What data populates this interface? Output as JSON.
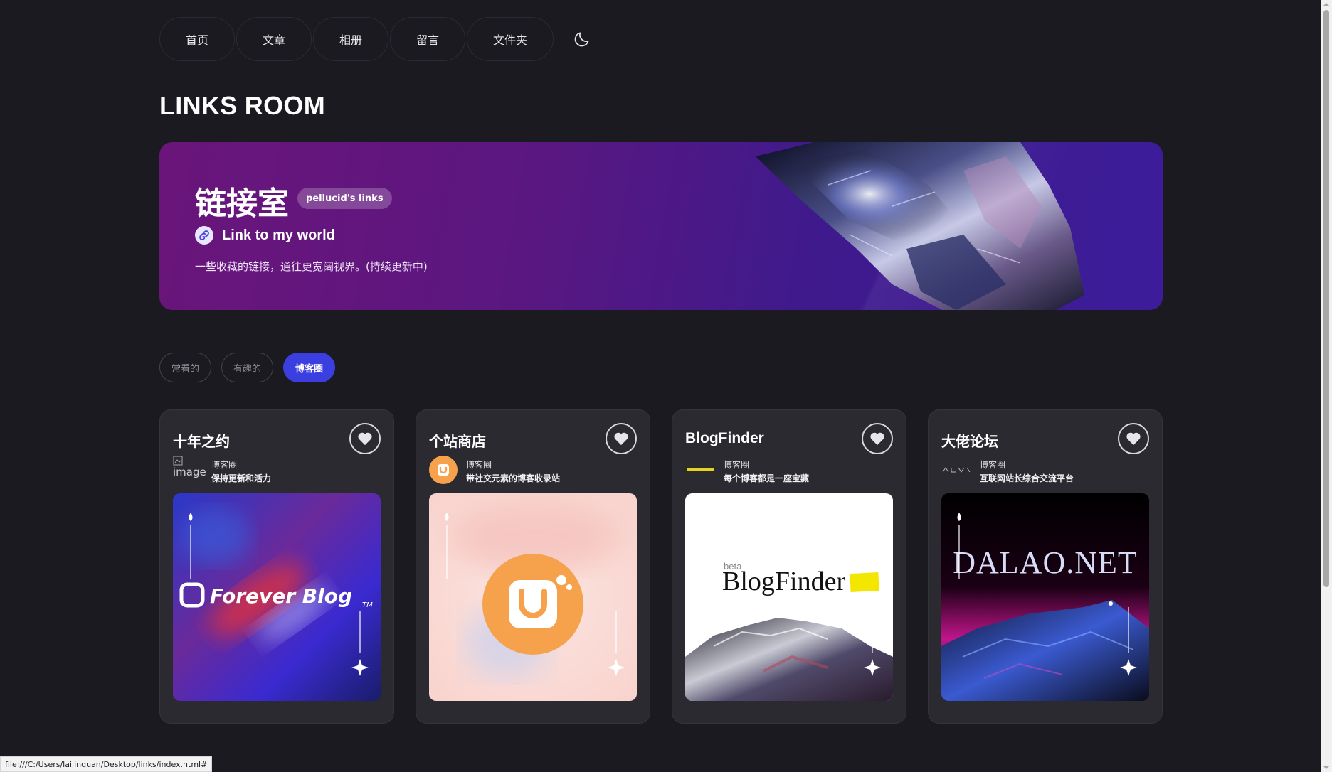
{
  "nav": {
    "items": [
      {
        "label": "首页"
      },
      {
        "label": "文章"
      },
      {
        "label": "相册"
      },
      {
        "label": "留言"
      },
      {
        "label": "文件夹"
      }
    ],
    "theme_icon": "moon-icon"
  },
  "page_title": "LINKS ROOM",
  "banner": {
    "title": "链接室",
    "badge": "pellucid's links",
    "subtitle": "Link to my world",
    "description": "一些收藏的链接，通往更宽阔视界。(持续更新中)"
  },
  "filters": [
    {
      "label": "常看的",
      "active": false
    },
    {
      "label": "有趣的",
      "active": false
    },
    {
      "label": "博客圈",
      "active": true
    }
  ],
  "cards": [
    {
      "name": "十年之约",
      "category": "博客圈",
      "description": "保持更新和活力",
      "avatar_alt": "image",
      "thumb_text": "Forever Blog",
      "thumb_tm": "TM"
    },
    {
      "name": "个站商店",
      "category": "博客圈",
      "description": "带社交元素的博客收录站"
    },
    {
      "name": "BlogFinder",
      "category": "博客圈",
      "description": "每个博客都是一座宝藏",
      "thumb_beta": "beta",
      "thumb_text": "BlogFinder"
    },
    {
      "name": "大佬论坛",
      "category": "博客圈",
      "description": "互联网站长综合交流平台",
      "thumb_text": "DALAO.NET"
    }
  ],
  "status_url": "file:///C:/Users/laijinquan/Desktop/links/index.html#",
  "colors": {
    "background": "#1b1a20",
    "card": "#2a2a30",
    "accent": "#3b3fe0",
    "banner_start": "#6a157a",
    "banner_end": "#3c1c9a"
  }
}
